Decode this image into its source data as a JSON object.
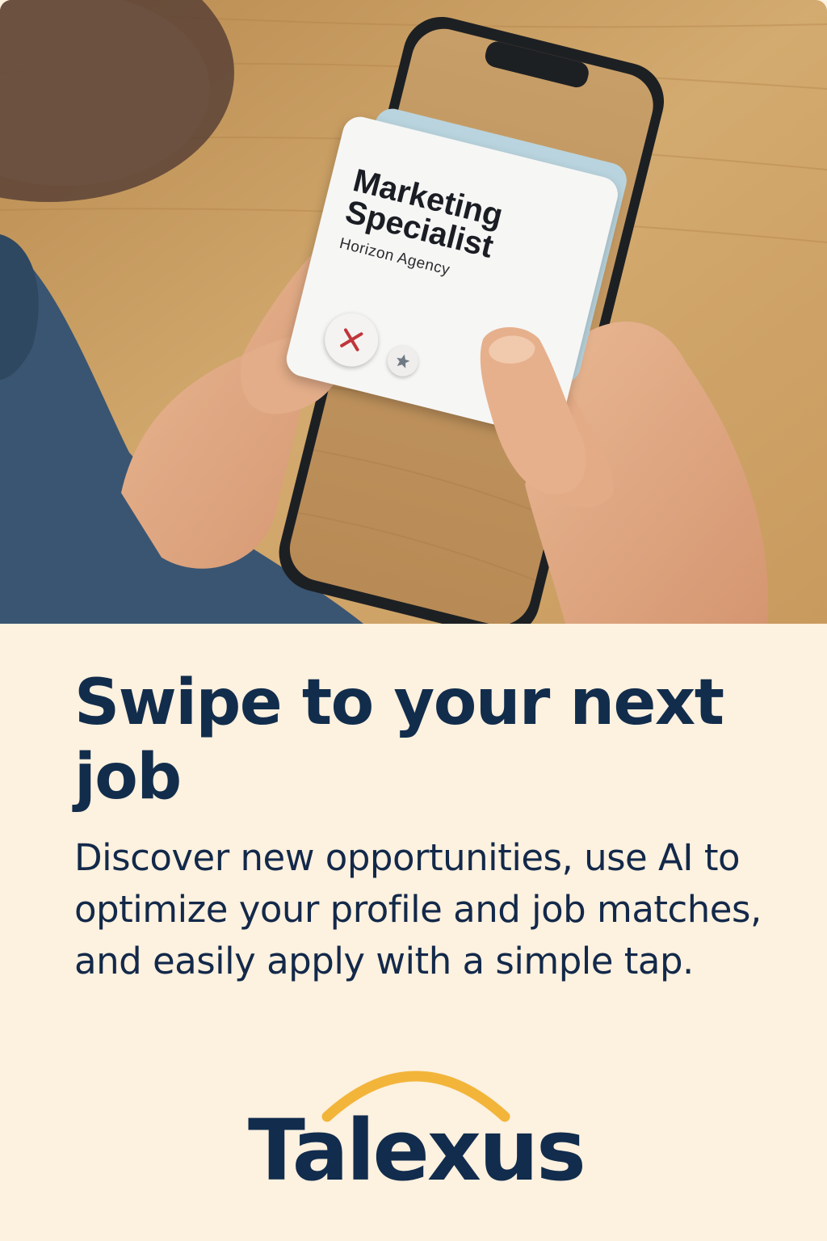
{
  "job_card": {
    "title": "Marketing Specialist",
    "company": "Horizon Agency",
    "reject_icon": "close-icon",
    "favorite_icon": "star-icon"
  },
  "hero": {
    "headline": "Swipe to your next job",
    "body": "Discover new opportunities, use AI to optimize your profile and job matches, and easily apply with a simple tap."
  },
  "brand": {
    "name": "Talexus",
    "arc_color": "#f2b53a",
    "text_color": "#112c4d"
  },
  "colors": {
    "background": "#fdf1df",
    "reject_red": "#c0353b",
    "star_gray": "#6f7a85"
  }
}
